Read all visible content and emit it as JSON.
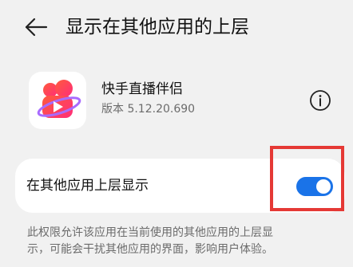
{
  "header": {
    "back_icon": "arrow-left-icon",
    "title": "显示在其他应用的上层"
  },
  "app": {
    "icon": "kuaishou-app-icon",
    "name": "快手直播伴侣",
    "version": "版本 5.12.20.690",
    "info_icon": "info-icon"
  },
  "setting": {
    "label": "在其他应用上层显示",
    "toggle_on": true,
    "toggle_color": "#1a73e8"
  },
  "description": {
    "line1": "此权限允许该应用在当前使用的其他应用的上层显",
    "line2": "示，可能会干扰其他应用的界面，影响用户体验。"
  },
  "colors": {
    "background": "#f1f1f1",
    "card": "#ffffff",
    "highlight": "#e53935"
  }
}
